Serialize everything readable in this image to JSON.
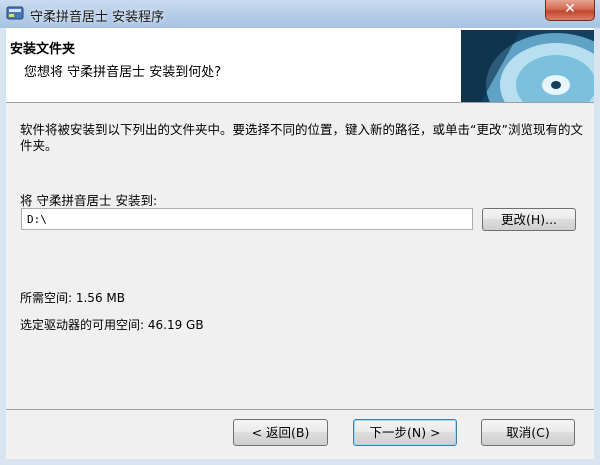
{
  "window": {
    "title": "守柔拼音居士 安装程序",
    "close_label": "✕"
  },
  "header": {
    "title": "安装文件夹",
    "subtitle": "您想将 守柔拼音居士 安装到何处?"
  },
  "content": {
    "description": "软件将被安装到以下列出的文件夹中。要选择不同的位置，键入新的路径，或单击“更改”浏览现有的文件夹。",
    "install_to_label": "将 守柔拼音居士 安装到:",
    "install_path": "D:\\",
    "change_button": "更改(H)...",
    "space_required": "所需空间: 1.56 MB",
    "space_available": "选定驱动器的可用空间: 46.19 GB"
  },
  "footer": {
    "back_button": "< 返回(B)",
    "next_button": "下一步(N) >",
    "cancel_button": "取消(C)"
  },
  "colors": {
    "titlebar": "#b5cde8",
    "close_button": "#c2462c",
    "client_background": "#f0f0f0",
    "header_background": "#ffffff"
  },
  "icons": {
    "app": "installer-icon",
    "header": "cd-disc-icon"
  }
}
